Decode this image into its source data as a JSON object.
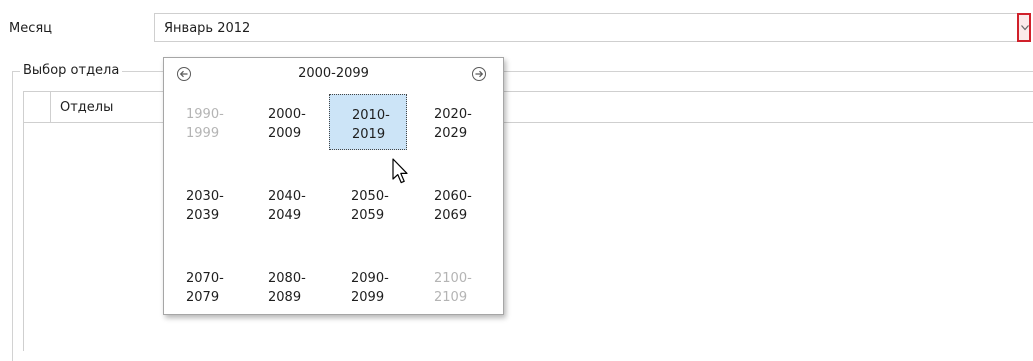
{
  "month_label": "Месяц",
  "month_value": "Январь 2012",
  "dept_group_title": "Выбор отдела",
  "grid": {
    "column_header": "Отделы"
  },
  "popup": {
    "title": "2000-2099",
    "cells": [
      {
        "start": "1990-",
        "end": "1999",
        "muted": true
      },
      {
        "start": "2000-",
        "end": "2009"
      },
      {
        "start": "2010-",
        "end": "2019",
        "selected": true
      },
      {
        "start": "2020-",
        "end": "2029"
      },
      {
        "start": "2030-",
        "end": "2039"
      },
      {
        "start": "2040-",
        "end": "2049"
      },
      {
        "start": "2050-",
        "end": "2059"
      },
      {
        "start": "2060-",
        "end": "2069"
      },
      {
        "start": "2070-",
        "end": "2079"
      },
      {
        "start": "2080-",
        "end": "2089"
      },
      {
        "start": "2090-",
        "end": "2099"
      },
      {
        "start": "2100-",
        "end": "2109",
        "muted": true
      }
    ]
  },
  "icons": {
    "prev": "arrow-left-circle-icon",
    "next": "arrow-right-circle-icon",
    "dropdown": "chevron-down-icon",
    "cursor": "mouse-pointer-icon"
  },
  "colors": {
    "selected_bg": "#cce4f7",
    "muted_text": "#b4b4b4",
    "arrow_highlight": "#d0202a"
  }
}
